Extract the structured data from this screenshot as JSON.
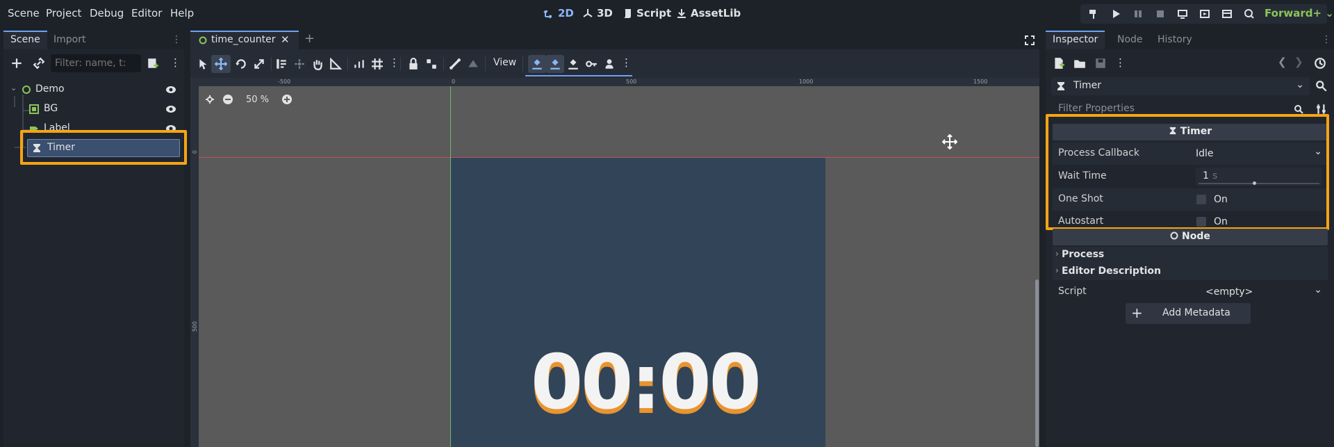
{
  "menu": {
    "items": [
      "Scene",
      "Project",
      "Debug",
      "Editor",
      "Help"
    ]
  },
  "workspaces": {
    "two_d": "2D",
    "three_d": "3D",
    "script": "Script",
    "assetlib": "AssetLib"
  },
  "renderer": "Forward+",
  "scene_dock": {
    "tabs": [
      "Scene",
      "Import"
    ],
    "filter_placeholder": "Filter: name, t:",
    "nodes": [
      {
        "label": "Demo",
        "icon": "node2d-circle-icon"
      },
      {
        "label": "BG",
        "icon": "colorrect-icon"
      },
      {
        "label": "Label",
        "icon": "label-icon"
      },
      {
        "label": "Timer",
        "icon": "hourglass-icon"
      }
    ]
  },
  "editor": {
    "tab_name": "time_counter",
    "view_menu": "View",
    "zoom": "50 %",
    "ruler_labels": [
      "-500",
      "0",
      "500",
      "1000",
      "1500"
    ],
    "ruler_left_labels": [
      "0",
      "500"
    ],
    "clock_text": "00:00"
  },
  "inspector": {
    "tabs": [
      "Inspector",
      "Node",
      "History"
    ],
    "object_name": "Timer",
    "filter_placeholder": "Filter Properties",
    "timer_section": "Timer",
    "props": {
      "process_callback": {
        "name": "Process Callback",
        "value": "Idle"
      },
      "wait_time": {
        "name": "Wait Time",
        "value": "1",
        "unit": "s"
      },
      "one_shot": {
        "name": "One Shot",
        "value": "On"
      },
      "autostart": {
        "name": "Autostart",
        "value": "On"
      }
    },
    "node_section": "Node",
    "process_group": "Process",
    "editor_description_group": "Editor Description",
    "script": {
      "name": "Script",
      "value": "<empty>"
    },
    "add_metadata": "Add Metadata"
  },
  "colors": {
    "accent": "#6ea3f0",
    "highlight": "#f6a414",
    "renderer": "#8cc55a",
    "clock_shadow": "#e89430"
  }
}
